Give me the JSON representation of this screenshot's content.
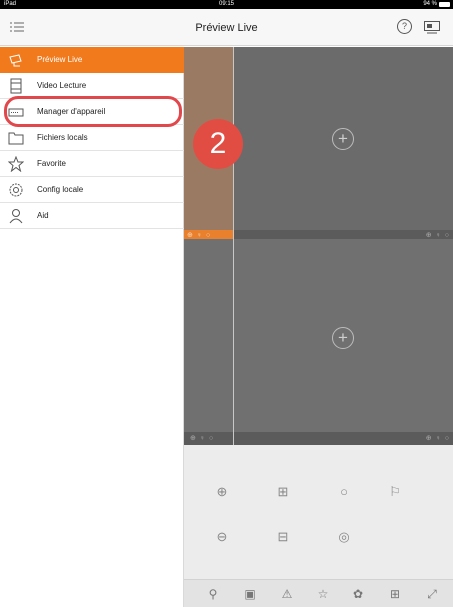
{
  "status_bar": {
    "device": "iPad",
    "time": "09:15",
    "battery": "94 %"
  },
  "nav": {
    "title": "Préview Live"
  },
  "sidebar": {
    "items": [
      {
        "label": "Préview Live",
        "icon": "camera-icon",
        "active": true
      },
      {
        "label": "Video Lecture",
        "icon": "film-icon"
      },
      {
        "label": "Manager d'appareil",
        "icon": "device-manager-icon"
      },
      {
        "label": "Fichiers locals",
        "icon": "folder-icon"
      },
      {
        "label": "Favorite",
        "icon": "star-icon"
      },
      {
        "label": "Config locale",
        "icon": "gear-icon"
      },
      {
        "label": "Aid",
        "icon": "person-icon"
      }
    ]
  },
  "annotation": {
    "step": "2"
  },
  "video_grid": {
    "cell_icons": "⊕ ♀ ○"
  },
  "colors": {
    "accent": "#f07a1c",
    "highlight": "#e2474b",
    "badge": "#e24d43"
  }
}
